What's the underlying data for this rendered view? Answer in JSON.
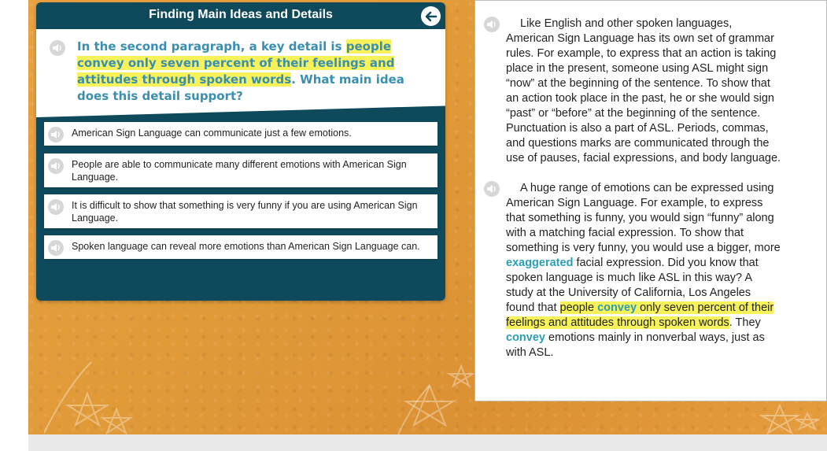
{
  "panel": {
    "title": "Finding Main Ideas and Details",
    "prompt": {
      "part1": "In the second paragraph, a key detail is ",
      "highlight": "people convey only seven percent of their feelings and attitudes through spoken words",
      "part2": ". What main idea does this detail support?"
    },
    "options": [
      {
        "label": "American Sign Language can communicate just a few emotions."
      },
      {
        "label": "People are able to communicate many different emotions with American Sign Language."
      },
      {
        "label": "It is difficult to show that something is very funny if you are using American Sign Language."
      },
      {
        "label": "Spoken language can reveal more emotions than American Sign Language can."
      }
    ]
  },
  "passage": {
    "paragraph1": "Like English and other spoken languages, American Sign Language has its own set of grammar rules. For example, to express that an action is taking place in the present, someone using ASL might sign “now” at the beginning of the sentence. To show that an action took place in the past, he or she would sign “past” or “before” at the beginning of the sentence. Punctuation is also a part of ASL. Periods, commas, and questions marks are communicated through the use of pauses, facial expressions, and body language.",
    "paragraph2": {
      "a": "A huge range of emotions can be expressed using American Sign Language. For example, to express that something is funny, you would sign “funny” along with a matching facial expression. To show that something is very funny, you would use a bigger, more ",
      "vocab1": "exaggerated",
      "b": " facial expression. Did you know that spoken language is much like ASL in this way? A study at the University of California, Los Angeles found that ",
      "hl_a": "people ",
      "vocab2": "convey",
      "hl_b": " only seven percent of their feelings and attitudes through spoken words",
      "c": ". They ",
      "vocab3": "convey",
      "d": " emotions mainly in nonverbal ways, just as with ASL."
    }
  },
  "colors": {
    "panel": "#0e4a5b",
    "prompt_text": "#3a8fb0",
    "highlight": "#f7f25a",
    "vocab": "#2a9db5",
    "background": "#e09a38"
  },
  "icons": [
    "back-arrow-icon",
    "speaker-icon"
  ]
}
